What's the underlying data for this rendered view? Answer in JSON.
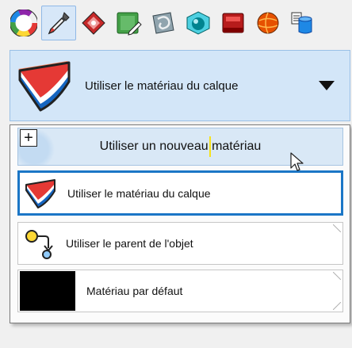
{
  "toolbar": {
    "tools": [
      {
        "name": "color-wheel-icon",
        "active": false
      },
      {
        "name": "eyedropper-icon",
        "active": true
      },
      {
        "name": "material-drop-icon",
        "active": false
      },
      {
        "name": "image-edit-icon",
        "active": false
      },
      {
        "name": "texture-swirl-icon",
        "active": false
      },
      {
        "name": "cube-sphere-icon",
        "active": false
      },
      {
        "name": "red-panel-icon",
        "active": false
      },
      {
        "name": "orange-sphere-icon",
        "active": false
      },
      {
        "name": "database-icon",
        "active": false
      }
    ]
  },
  "selector": {
    "label": "Utiliser le matériau du calque",
    "icon": "layer-material-icon"
  },
  "dropdown": {
    "new_material_label": "Utiliser un nouveau matériau",
    "new_material_plus": "+",
    "items": [
      {
        "label": "Utiliser le matériau du calque",
        "icon": "layer-material-icon",
        "selected": true
      },
      {
        "label": "Utiliser le parent de l'objet",
        "icon": "object-parent-icon",
        "selected": false
      },
      {
        "label": "Matériau par défaut",
        "icon": "default-material-swatch",
        "selected": false
      }
    ]
  },
  "colors": {
    "selection_border": "#1b76c6",
    "hover_background": "#d9e8f6",
    "selector_background": "#d3e6f8"
  }
}
